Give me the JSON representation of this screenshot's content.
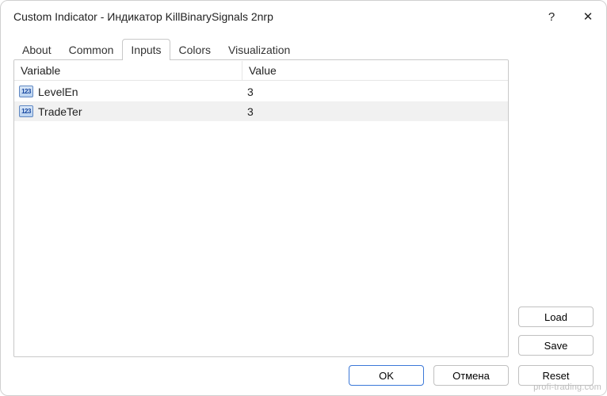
{
  "window": {
    "title": "Custom Indicator - Индикатор KillBinarySignals 2nrp",
    "help_tooltip": "?",
    "close_tooltip": "✕"
  },
  "tabs": [
    {
      "label": "About",
      "active": false
    },
    {
      "label": "Common",
      "active": false
    },
    {
      "label": "Inputs",
      "active": true
    },
    {
      "label": "Colors",
      "active": false
    },
    {
      "label": "Visualization",
      "active": false
    }
  ],
  "table": {
    "headers": {
      "variable": "Variable",
      "value": "Value"
    },
    "rows": [
      {
        "icon": "123",
        "name": "LevelEn",
        "value": "3"
      },
      {
        "icon": "123",
        "name": "TradeTer",
        "value": "3"
      }
    ]
  },
  "side_buttons": {
    "load": "Load",
    "save": "Save"
  },
  "footer_buttons": {
    "ok": "OK",
    "cancel": "Отмена",
    "reset": "Reset"
  },
  "watermark": "profi-trading.com"
}
